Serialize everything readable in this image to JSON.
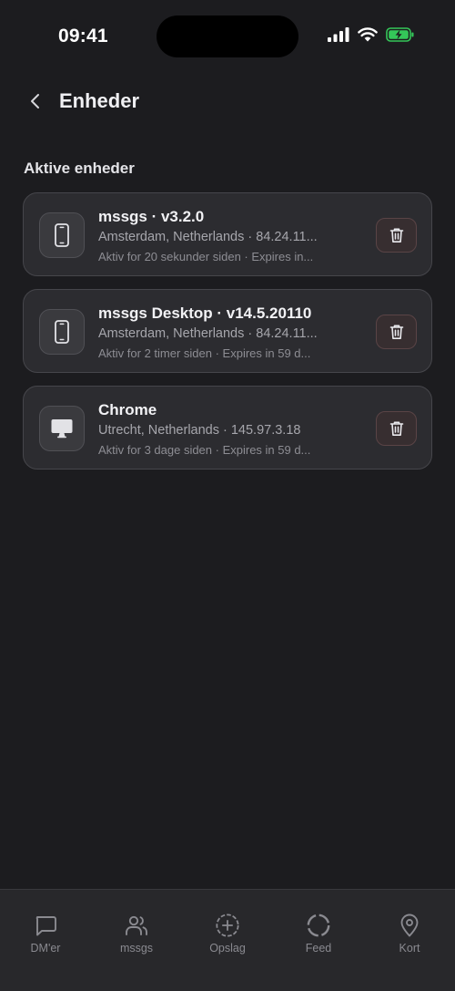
{
  "status_bar": {
    "time": "09:41"
  },
  "header": {
    "title": "Enheder"
  },
  "section_title": "Aktive enheder",
  "devices": [
    {
      "icon": "phone-icon",
      "name": "mssgs · v3.2.0",
      "location": "Amsterdam, Netherlands · 84.24.11...",
      "activity": "Aktiv for 20 sekunder siden · Expires in..."
    },
    {
      "icon": "phone-icon",
      "name": "mssgs Desktop · v14.5.20110",
      "location": "Amsterdam, Netherlands · 84.24.11...",
      "activity": "Aktiv for 2 timer siden · Expires in 59 d..."
    },
    {
      "icon": "desktop-icon",
      "name": "Chrome",
      "location": "Utrecht, Netherlands · 145.97.3.18",
      "activity": "Aktiv for 3 dage siden · Expires in 59 d..."
    }
  ],
  "tabs": [
    {
      "label": "DM'er",
      "icon": "chat-bubble-icon"
    },
    {
      "label": "mssgs",
      "icon": "users-icon"
    },
    {
      "label": "Opslag",
      "icon": "add-circle-icon"
    },
    {
      "label": "Feed",
      "icon": "feed-circle-icon"
    },
    {
      "label": "Kort",
      "icon": "map-pin-icon"
    }
  ],
  "colors": {
    "background": "#1c1c1f",
    "card": "#2c2c30",
    "battery": "#34c759",
    "delete_accent": "#5a4446"
  }
}
